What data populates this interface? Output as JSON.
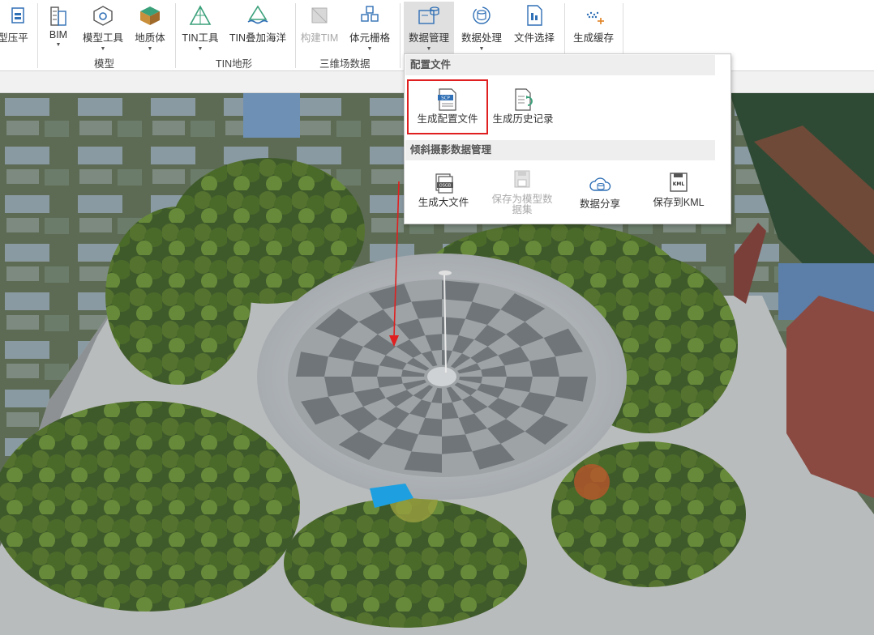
{
  "ribbon": {
    "buttons": {
      "model_flatten": "型压平",
      "bim": "BIM",
      "model_tools": "模型工具",
      "geo_body": "地质体",
      "tin_tools": "TIN工具",
      "tin_ocean": "TIN叠加海洋",
      "build_tim": "构建TIM",
      "voxel_grid": "体元栅格",
      "data_manage": "数据管理",
      "data_process": "数据处理",
      "file_select": "文件选择",
      "gen_cache": "生成缓存"
    },
    "groups": {
      "model": "模型",
      "tin_terrain": "TIN地形",
      "field_3d": "三维场数据"
    }
  },
  "dropdown": {
    "section_config": "配置文件",
    "gen_config": "生成配置文件",
    "gen_history": "生成历史记录",
    "section_oblique": "倾斜摄影数据管理",
    "gen_big_file": "生成大文件",
    "save_as_dataset_line1": "保存为模型数",
    "save_as_dataset_line2": "据集",
    "data_share": "数据分享",
    "save_kml": "保存到KML",
    "scp_badge": "SCP",
    "osgb_badge": "OSGB",
    "kml_badge": "KML"
  },
  "colors": {
    "selection_border": "#e02020",
    "arrow": "#e02020",
    "icon_blue": "#2f6fb5",
    "icon_green": "#3aa07a"
  }
}
